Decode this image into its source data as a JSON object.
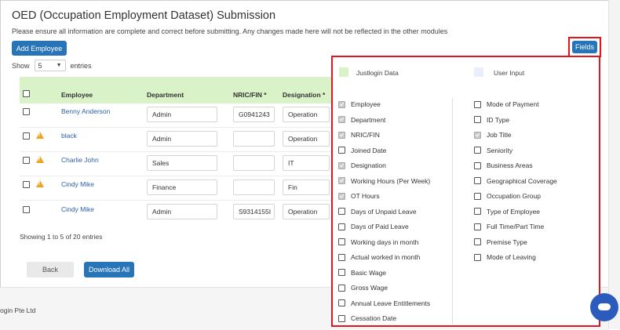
{
  "header": {
    "title": "OED (Occupation Employment Dataset) Submission",
    "subtitle": "Please ensure all information are complete and correct before submitting. Any changes made here will not be reflected in the other modules"
  },
  "toolbar": {
    "add_employee_label": "Add Employee",
    "fields_label": "Fields"
  },
  "show_entries": {
    "prefix": "Show",
    "value": "5",
    "suffix": "entries"
  },
  "table": {
    "columns": [
      "Employee",
      "Department",
      "NRIC/FIN *",
      "Designation *"
    ],
    "rows": [
      {
        "employee": "Benny Anderson",
        "department": "Admin",
        "nric": "G0941243",
        "designation": "Operation",
        "warning": false
      },
      {
        "employee": "black",
        "department": "Admin",
        "nric": "",
        "designation": "Operation",
        "warning": true
      },
      {
        "employee": "Charlie John",
        "department": "Sales",
        "nric": "",
        "designation": "IT",
        "warning": true
      },
      {
        "employee": "Cindy Mike",
        "department": "Finance",
        "nric": "",
        "designation": "Fin",
        "warning": true
      },
      {
        "employee": "Cindy Mike",
        "department": "Admin",
        "nric": "S9314155I",
        "designation": "Operation",
        "warning": false
      }
    ]
  },
  "pagination": {
    "showing_text": "Showing 1 to 5 of 20 entries"
  },
  "actions": {
    "back_label": "Back",
    "download_all_label": "Download All"
  },
  "footer": {
    "company": "ogin Pte Ltd"
  },
  "fields_panel": {
    "legend": [
      {
        "label": "Justlogin Data",
        "color": "#d9f2c7"
      },
      {
        "label": "User Input",
        "color": "#e8eefb"
      }
    ],
    "left_column": [
      {
        "label": "Employee",
        "checked": true
      },
      {
        "label": "Department",
        "checked": true
      },
      {
        "label": "NRIC/FIN",
        "checked": true
      },
      {
        "label": "Joined Date",
        "checked": false
      },
      {
        "label": "Designation",
        "checked": true
      },
      {
        "label": "Working Hours (Per Week)",
        "checked": true
      },
      {
        "label": "OT Hours",
        "checked": true
      },
      {
        "label": "Days of Unpaid Leave",
        "checked": false
      },
      {
        "label": "Days of Paid Leave",
        "checked": false
      },
      {
        "label": "Working days in month",
        "checked": false
      },
      {
        "label": "Actual worked in month",
        "checked": false
      },
      {
        "label": "Basic Wage",
        "checked": false
      },
      {
        "label": "Gross Wage",
        "checked": false
      },
      {
        "label": "Annual Leave Entitlements",
        "checked": false
      },
      {
        "label": "Cessation Date",
        "checked": false
      }
    ],
    "right_column": [
      {
        "label": "Mode of Payment",
        "checked": false
      },
      {
        "label": "ID Type",
        "checked": false
      },
      {
        "label": "Job Title",
        "checked": true
      },
      {
        "label": "Seniority",
        "checked": false
      },
      {
        "label": "Business Areas",
        "checked": false
      },
      {
        "label": "Geographical Coverage",
        "checked": false
      },
      {
        "label": "Occupation Group",
        "checked": false
      },
      {
        "label": "Type of Employee",
        "checked": false
      },
      {
        "label": "Full Time/Part Time",
        "checked": false
      },
      {
        "label": "Premise Type",
        "checked": false
      },
      {
        "label": "Mode of Leaving",
        "checked": false
      }
    ]
  },
  "colors": {
    "accent": "#2874b9",
    "highlight": "#e3141c",
    "header_bg": "#d9f2c7",
    "warning": "#f0a21a"
  }
}
